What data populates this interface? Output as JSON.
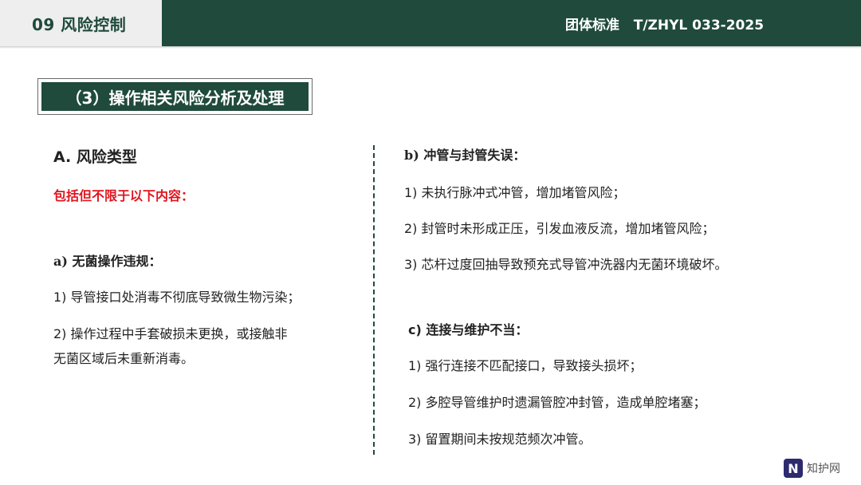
{
  "header": {
    "section": "09  风险控制",
    "standard": "团体标准   T/ZHYL 033-2025"
  },
  "title": "（3）操作相关风险分析及处理",
  "left": {
    "heading": "A. 风险类型",
    "note": "包括但不限于以下内容：",
    "a_title": "a) 无菌操作违规：",
    "a1": "1) 导管接口处消毒不彻底导致微生物污染；",
    "a2_line1": "2) 操作过程中手套破损未更换，或接触非",
    "a2_line2": "无菌区域后未重新消毒。"
  },
  "right": {
    "b_title": "b) 冲管与封管失误：",
    "b1": "1) 未执行脉冲式冲管，增加堵管风险；",
    "b2": "2) 封管时未形成正压，引发血液反流，增加堵管风险；",
    "b3": "3) 芯杆过度回抽导致预充式导管冲洗器内无菌环境破坏。",
    "c_title": "c) 连接与维护不当：",
    "c1": "1) 强行连接不匹配接口，导致接头损坏；",
    "c2": "2) 多腔导管维护时遗漏管腔冲封管，造成单腔堵塞；",
    "c3": "3) 留置期间未按规范频次冲管。"
  },
  "watermark": {
    "mark": "N",
    "text": "知护网"
  },
  "colors": {
    "brand_green": "#1f4a3c",
    "alert_red": "#e0141e"
  }
}
